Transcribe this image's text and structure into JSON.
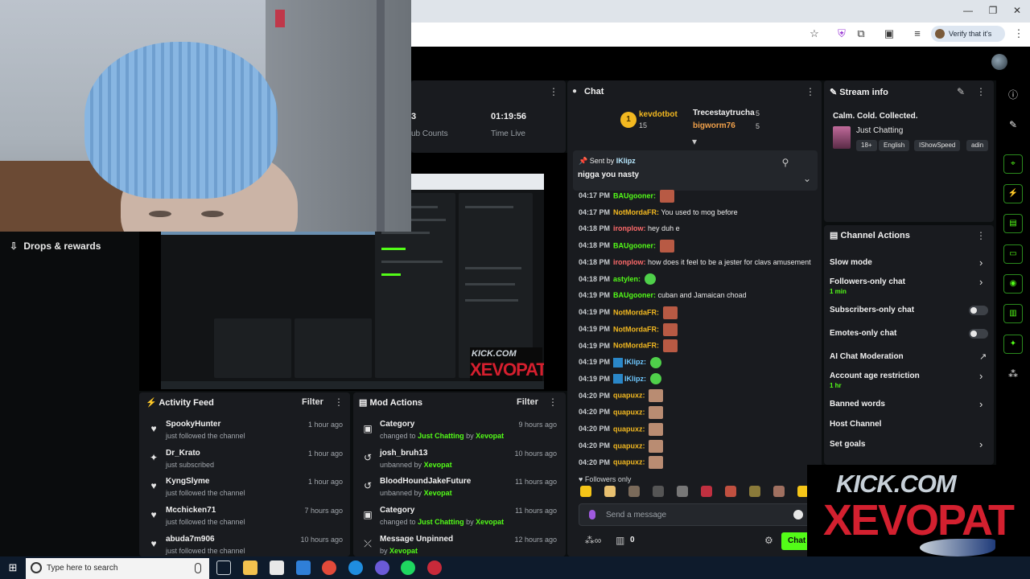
{
  "browser": {
    "verify_chip": "Verify that it's you",
    "controls": {
      "minimize": "—",
      "restore": "❐",
      "close": "✕"
    }
  },
  "left": {
    "drops_label": "Drops & rewards"
  },
  "stats": {
    "subs_label": "ub Counts",
    "subs_value_fragment": "3",
    "time_value": "01:19:56",
    "time_label": "Time Live"
  },
  "chat": {
    "title": "Chat",
    "leaderboard": [
      {
        "rank": "1",
        "name": "kevdotbot",
        "count": "15",
        "color": "#f2b820"
      },
      {
        "rank": "",
        "name": "Trecestaytrucha",
        "count": "5",
        "color": "#f0f0f0"
      },
      {
        "rank": "",
        "name": "bigworm76",
        "count": "5",
        "color": "#f0a04a"
      }
    ],
    "pinned": {
      "prefix": "Sent by",
      "user": "IKlipz",
      "message": "nigga you nasty"
    },
    "messages": [
      {
        "time": "04:17 PM",
        "user": "BAUgooner:",
        "color": "#53fc18",
        "text": "",
        "emote": "face"
      },
      {
        "time": "04:17 PM",
        "user": "NotMordaFR:",
        "color": "#f2b820",
        "text": "You used to mog before",
        "emote": ""
      },
      {
        "time": "04:18 PM",
        "user": "ironplow:",
        "color": "#ff6b6b",
        "text": "hey duh e",
        "emote": ""
      },
      {
        "time": "04:18 PM",
        "user": "BAUgooner:",
        "color": "#53fc18",
        "text": "",
        "emote": "face"
      },
      {
        "time": "04:18 PM",
        "user": "ironplow:",
        "color": "#ff6b6b",
        "text": "how does it feel to be a jester for clavs amusement",
        "emote": ""
      },
      {
        "time": "04:18 PM",
        "user": "astylen:",
        "color": "#53fc18",
        "text": "",
        "emote": "green"
      },
      {
        "time": "04:19 PM",
        "user": "BAUgooner:",
        "color": "#53fc18",
        "text": "cuban and Jamaican choad",
        "emote": ""
      },
      {
        "time": "04:19 PM",
        "user": "NotMordaFR:",
        "color": "#f2b820",
        "text": "",
        "emote": "face"
      },
      {
        "time": "04:19 PM",
        "user": "NotMordaFR:",
        "color": "#f2b820",
        "text": "",
        "emote": "face"
      },
      {
        "time": "04:19 PM",
        "user": "NotMordaFR:",
        "color": "#f2b820",
        "text": "",
        "emote": "face"
      },
      {
        "time": "04:19 PM",
        "user": "IKlipz:",
        "color": "#6fc8ff",
        "text": "",
        "emote": "green",
        "badge": true
      },
      {
        "time": "04:19 PM",
        "user": "IKlipz:",
        "color": "#6fc8ff",
        "text": "",
        "emote": "green",
        "badge": true
      },
      {
        "time": "04:20 PM",
        "user": "quapuxz:",
        "color": "#f2b820",
        "text": "",
        "emote": "person"
      },
      {
        "time": "04:20 PM",
        "user": "quapuxz:",
        "color": "#f2b820",
        "text": "",
        "emote": "person"
      },
      {
        "time": "04:20 PM",
        "user": "quapuxz:",
        "color": "#f2b820",
        "text": "",
        "emote": "person"
      },
      {
        "time": "04:20 PM",
        "user": "quapuxz:",
        "color": "#f2b820",
        "text": "",
        "emote": "person"
      },
      {
        "time": "04:20 PM",
        "user": "quapuxz:",
        "color": "#f2b820",
        "text": "",
        "emote": "person"
      }
    ],
    "followers_only": "Followers only",
    "input_placeholder": "Send a message",
    "footer_count": "0",
    "send_label": "Chat"
  },
  "activity_feed": {
    "title": "Activity Feed",
    "filter": "Filter",
    "items": [
      {
        "icon": "heart-icon",
        "name": "SpookyHunter",
        "sub": "just followed the channel",
        "time": "1 hour ago"
      },
      {
        "icon": "sparkle-icon",
        "name": "Dr_Krato",
        "sub": "just subscribed",
        "time": "1 hour ago"
      },
      {
        "icon": "heart-icon",
        "name": "KyngSlyme",
        "sub": "just followed the channel",
        "time": "1 hour ago"
      },
      {
        "icon": "heart-icon",
        "name": "Mcchicken71",
        "sub": "just followed the channel",
        "time": "7 hours ago"
      },
      {
        "icon": "heart-icon",
        "name": "abuda7m906",
        "sub": "just followed the channel",
        "time": "10 hours ago"
      }
    ]
  },
  "mod_actions": {
    "title": "Mod Actions",
    "filter": "Filter",
    "items": [
      {
        "icon": "category-icon",
        "name": "Category",
        "sub_pre": "changed to",
        "sub_hl1": "Just Chatting",
        "sub_mid": "by",
        "sub_hl2": "Xevopat",
        "time": "9 hours ago"
      },
      {
        "icon": "undo-icon",
        "name": "josh_bruh13",
        "sub_pre": "unbanned by",
        "sub_hl1": "Xevopat",
        "sub_mid": "",
        "sub_hl2": "",
        "time": "10 hours ago"
      },
      {
        "icon": "undo-icon",
        "name": "BloodHoundJakeFuture",
        "sub_pre": "unbanned by",
        "sub_hl1": "Xevopat",
        "sub_mid": "",
        "sub_hl2": "",
        "time": "11 hours ago"
      },
      {
        "icon": "category-icon",
        "name": "Category",
        "sub_pre": "changed to",
        "sub_hl1": "Just Chatting",
        "sub_mid": "by",
        "sub_hl2": "Xevopat",
        "time": "11 hours ago"
      },
      {
        "icon": "unpin-icon",
        "name": "Message Unpinned",
        "sub_pre": "by",
        "sub_hl1": "Xevopat",
        "sub_mid": "",
        "sub_hl2": "",
        "time": "12 hours ago"
      }
    ]
  },
  "stream_info": {
    "title": "Stream info",
    "stream_title": "Calm. Cold. Collected.",
    "category": "Just Chatting",
    "tags": [
      "18+",
      "English",
      "IShowSpeed",
      "adin"
    ]
  },
  "channel_actions": {
    "title": "Channel Actions",
    "items": [
      {
        "label": "Slow mode",
        "sub": "",
        "control": "chevron"
      },
      {
        "label": "Followers-only chat",
        "sub": "1 min",
        "control": "chevron"
      },
      {
        "label": "Subscribers-only chat",
        "sub": "",
        "control": "toggle"
      },
      {
        "label": "Emotes-only chat",
        "sub": "",
        "control": "toggle"
      },
      {
        "label": "AI Chat Moderation",
        "sub": "",
        "control": "external"
      },
      {
        "label": "Account age restriction",
        "sub": "1 hr",
        "control": "chevron"
      },
      {
        "label": "Banned words",
        "sub": "",
        "control": "chevron"
      },
      {
        "label": "Host Channel",
        "sub": "",
        "control": "none"
      },
      {
        "label": "Set goals",
        "sub": "",
        "control": "chevron"
      }
    ]
  },
  "overlay_logo": {
    "top": "KICK.COM",
    "bottom": "XEVOPAT"
  },
  "taskbar": {
    "search_placeholder": "Type here to search"
  }
}
